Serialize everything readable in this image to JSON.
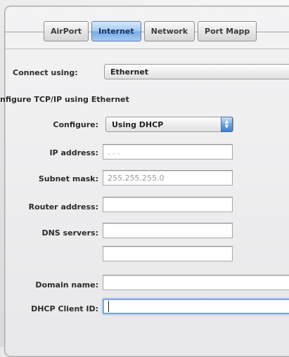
{
  "tabs": [
    {
      "label": "AirPort",
      "active": false
    },
    {
      "label": "Internet",
      "active": true
    },
    {
      "label": "Network",
      "active": false
    },
    {
      "label": "Port Mapp",
      "active": false
    }
  ],
  "connect_using": {
    "label": "Connect using:",
    "value": "Ethernet"
  },
  "section_title": "nfigure TCP/IP using Ethernet",
  "configure": {
    "label": "Configure:",
    "value": "Using DHCP"
  },
  "ip_address": {
    "label": "IP address:",
    "value": ".   .   ."
  },
  "subnet_mask": {
    "label": "Subnet mask:",
    "value": "255.255.255.0"
  },
  "router_address": {
    "label": "Router address:",
    "value": ""
  },
  "dns_servers": {
    "label": "DNS servers:",
    "value1": "",
    "value2": ""
  },
  "domain_name": {
    "label": "Domain name:",
    "value": ""
  },
  "dhcp_client_id": {
    "label": "DHCP Client ID:",
    "value": ""
  },
  "colors": {
    "active_tab": "#79aee8",
    "popup_arrows": "#3e7ed0"
  }
}
